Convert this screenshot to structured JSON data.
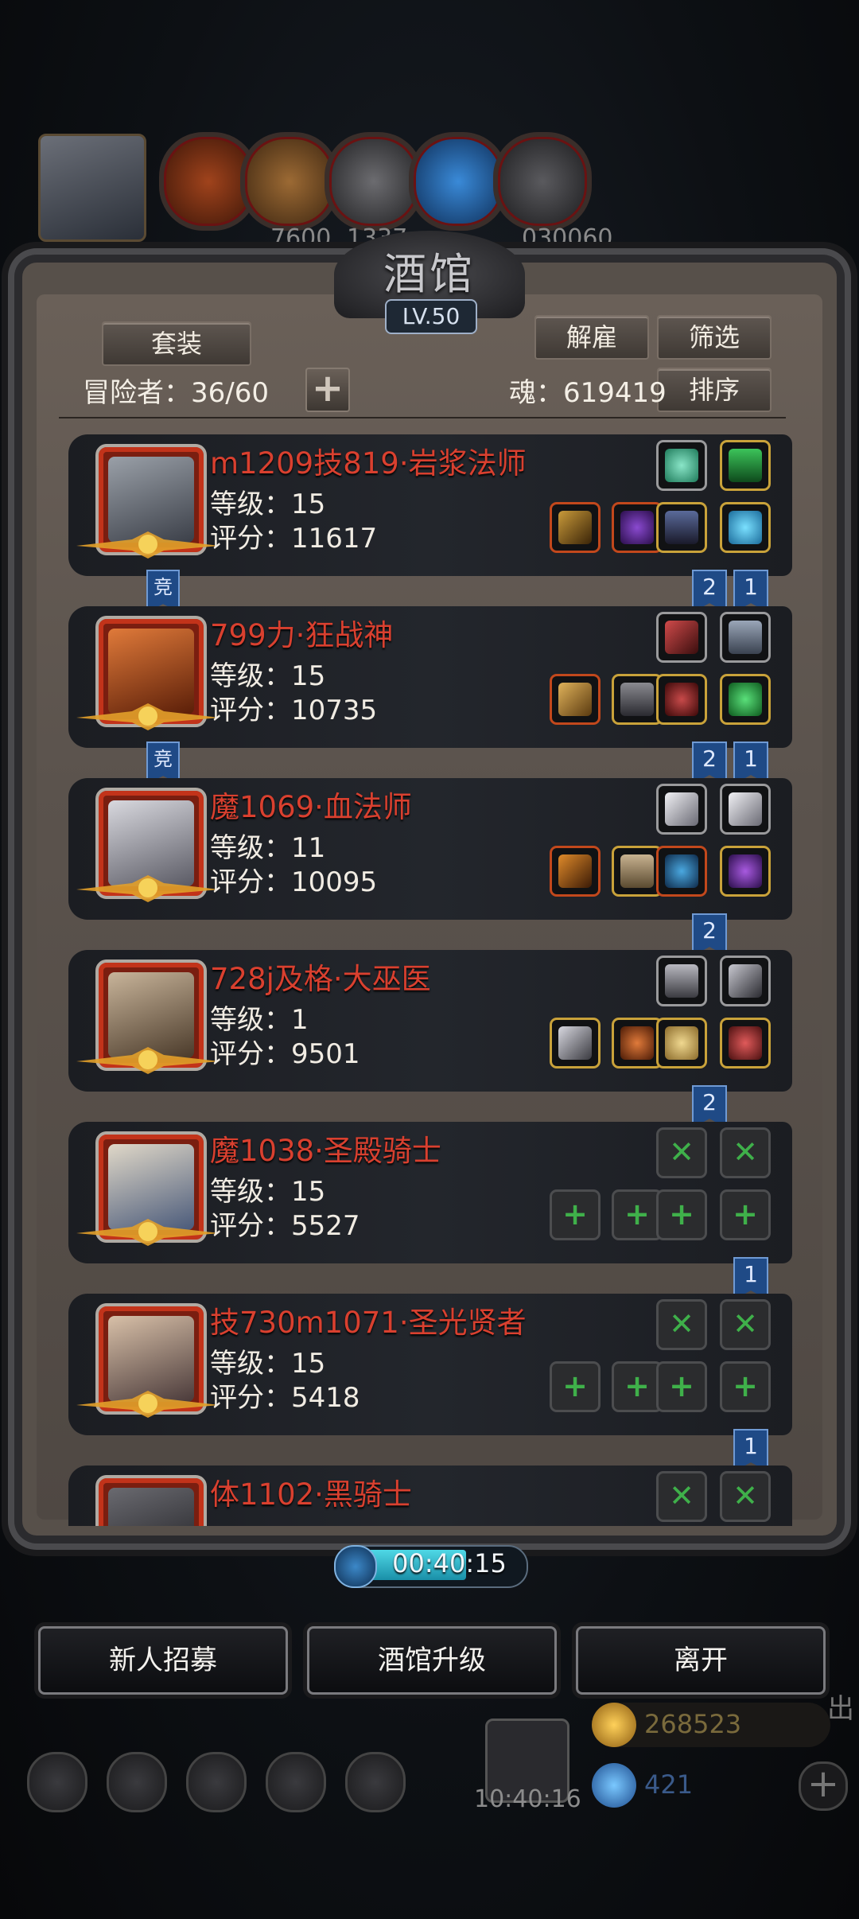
{
  "top_resources": {
    "values": [
      "",
      "7600",
      "1337",
      "",
      "030060"
    ]
  },
  "panel": {
    "title": "酒馆",
    "level": "LV.50",
    "btn_set": "套装",
    "btn_dismiss": "解雇",
    "btn_filter": "筛选",
    "btn_sort": "排序",
    "adventurers": "冒险者：36/60",
    "soul": "魂：619419",
    "plus": "+"
  },
  "heroes": [
    {
      "name": "m1209技819·岩浆法师",
      "level": "等级：15",
      "score": "评分：11617",
      "ribbons": [
        "2",
        "1"
      ],
      "jing": "竞"
    },
    {
      "name": "799力·狂战神",
      "level": "等级：15",
      "score": "评分：10735",
      "ribbons": [
        "2",
        "1"
      ],
      "jing": "竞"
    },
    {
      "name": "魔1069·血法师",
      "level": "等级：11",
      "score": "评分：10095",
      "ribbons": [
        "2"
      ]
    },
    {
      "name": "728j及格·大巫医",
      "level": "等级：1",
      "score": "评分：9501",
      "ribbons": [
        "2"
      ]
    },
    {
      "name": "魔1038·圣殿骑士",
      "level": "等级：15",
      "score": "评分：5527",
      "ribbons": [
        "1"
      ]
    },
    {
      "name": "技730m1071·圣光贤者",
      "level": "等级：15",
      "score": "评分：5418",
      "ribbons": [
        "1"
      ]
    },
    {
      "name": "体1102·黑骑士",
      "level": "",
      "score": "",
      "ribbons": []
    }
  ],
  "timer": "00:40:15",
  "buttons": {
    "recruit": "新人招募",
    "upgrade": "酒馆升级",
    "leave": "离开"
  },
  "hud": {
    "gift_time": "10:40:16",
    "gold": "268523",
    "gems": "421",
    "side_label": "出",
    "add": "+"
  },
  "colors": {
    "hero_name": "#d9402f",
    "ribbon": "#1f4a86",
    "timer_fill": "#4fd8e6"
  }
}
